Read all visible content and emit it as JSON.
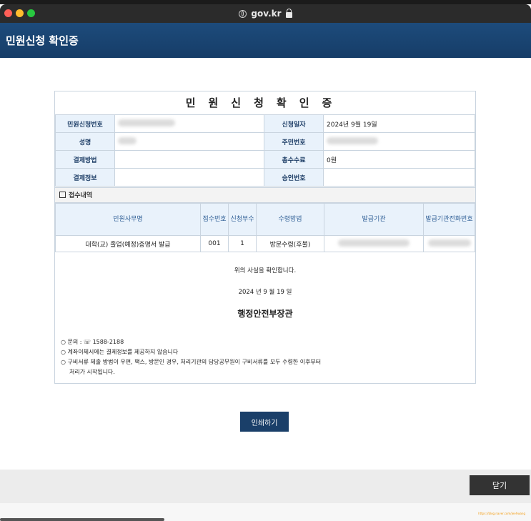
{
  "browser": {
    "domain": "gov.kr"
  },
  "header": {
    "title": "민원신청 확인증"
  },
  "certificate": {
    "title": "민원신청확인증",
    "fields": {
      "application_no_label": "민원신청번호",
      "application_date_label": "신청일자",
      "application_date_value": "2024년 9월 19일",
      "name_label": "성명",
      "resident_no_label": "주민번호",
      "payment_method_label": "결제방법",
      "total_fee_label": "총수수료",
      "total_fee_value": "0원",
      "payment_info_label": "결제정보",
      "approval_no_label": "승인번호"
    },
    "receipt_section_title": "접수내역",
    "receipt_table": {
      "headers": [
        "민원사무명",
        "접수번호",
        "신청부수",
        "수령방법",
        "발급기관",
        "발급기관전화번호"
      ],
      "rows": [
        {
          "service": "대학(교) 졸업(예정)증명서 발급",
          "receipt_no": "001",
          "copies": "1",
          "method": "방문수령(후불)"
        }
      ]
    },
    "confirm_text": "위의 사실을 확인합니다.",
    "date_text": "2024 년 9 월 19 일",
    "agency": "행정안전부장관",
    "notes": [
      "○ 문의 : ☏ 1588-2188",
      "○ 계좌이체시에는 결제정보를 제공하지 않습니다",
      "○ 구비서류 제출 방법이 우편, 팩스, 방문인 경우, 처리기관의 담당공무원이 구비서류를 모두 수령한 이후부터",
      "처리가 시작됩니다."
    ]
  },
  "buttons": {
    "print": "인쇄하기",
    "close": "닫기"
  },
  "credit": "https://blog.naver.com/jeehwang"
}
